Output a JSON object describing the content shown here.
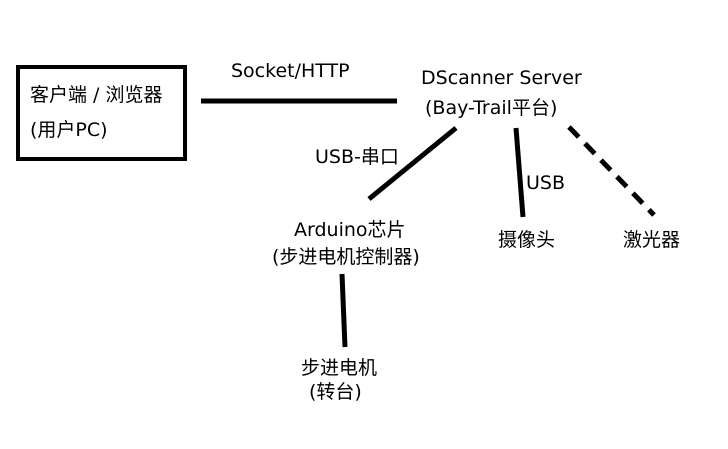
{
  "diagram": {
    "client": {
      "line1": "客户端 / 浏览器",
      "line2": "(用户PC)"
    },
    "server": {
      "line1": "DScanner Server",
      "line2": "(Bay-Trail平台)"
    },
    "arduino": {
      "line1": "Arduino芯片",
      "line2": "(步进电机控制器)"
    },
    "camera": "摄像头",
    "laser": "激光器",
    "motor": {
      "line1": "步进电机",
      "line2": "(转台)"
    },
    "links": {
      "client_server": "Socket/HTTP",
      "server_arduino": "USB-串口",
      "server_camera": "USB"
    }
  }
}
